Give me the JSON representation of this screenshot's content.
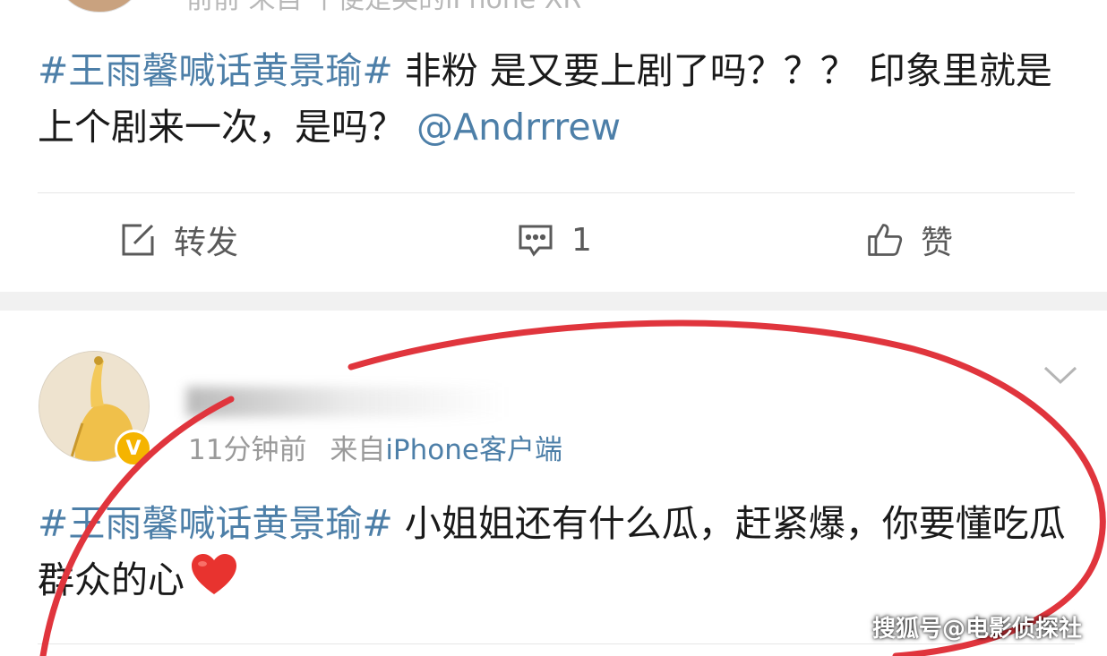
{
  "post1": {
    "meta": "前前  来自 千便是笑的iPhone XR",
    "hashtag": "#王雨馨喊话黄景瑜#",
    "text": " 非粉 是又要上剧了吗？？？ 印象里就是上个剧来一次，是吗？",
    "mention": "@Andrrrew",
    "actions": {
      "repost_label": "转发",
      "comment_count": "1",
      "like_label": "赞"
    }
  },
  "post2": {
    "time": "11分钟前",
    "from_label": "来自",
    "source": "iPhone客户端",
    "badge": "V",
    "hashtag": "#王雨馨喊话黄景瑜#",
    "text": " 小姐姐还有什么瓜，赶紧爆，你要懂吃瓜群众的心"
  },
  "icons": {
    "repost": "edit-share-icon",
    "comment": "comment-icon",
    "like": "thumbs-up-icon",
    "more": "chevron-down-icon",
    "heart": "heart-icon"
  },
  "colors": {
    "link": "#4d7fa8",
    "annotation": "#e0353d",
    "heart": "#e8332f",
    "badge": "#f5b400"
  },
  "watermark": "搜狐号@电影侦探社"
}
